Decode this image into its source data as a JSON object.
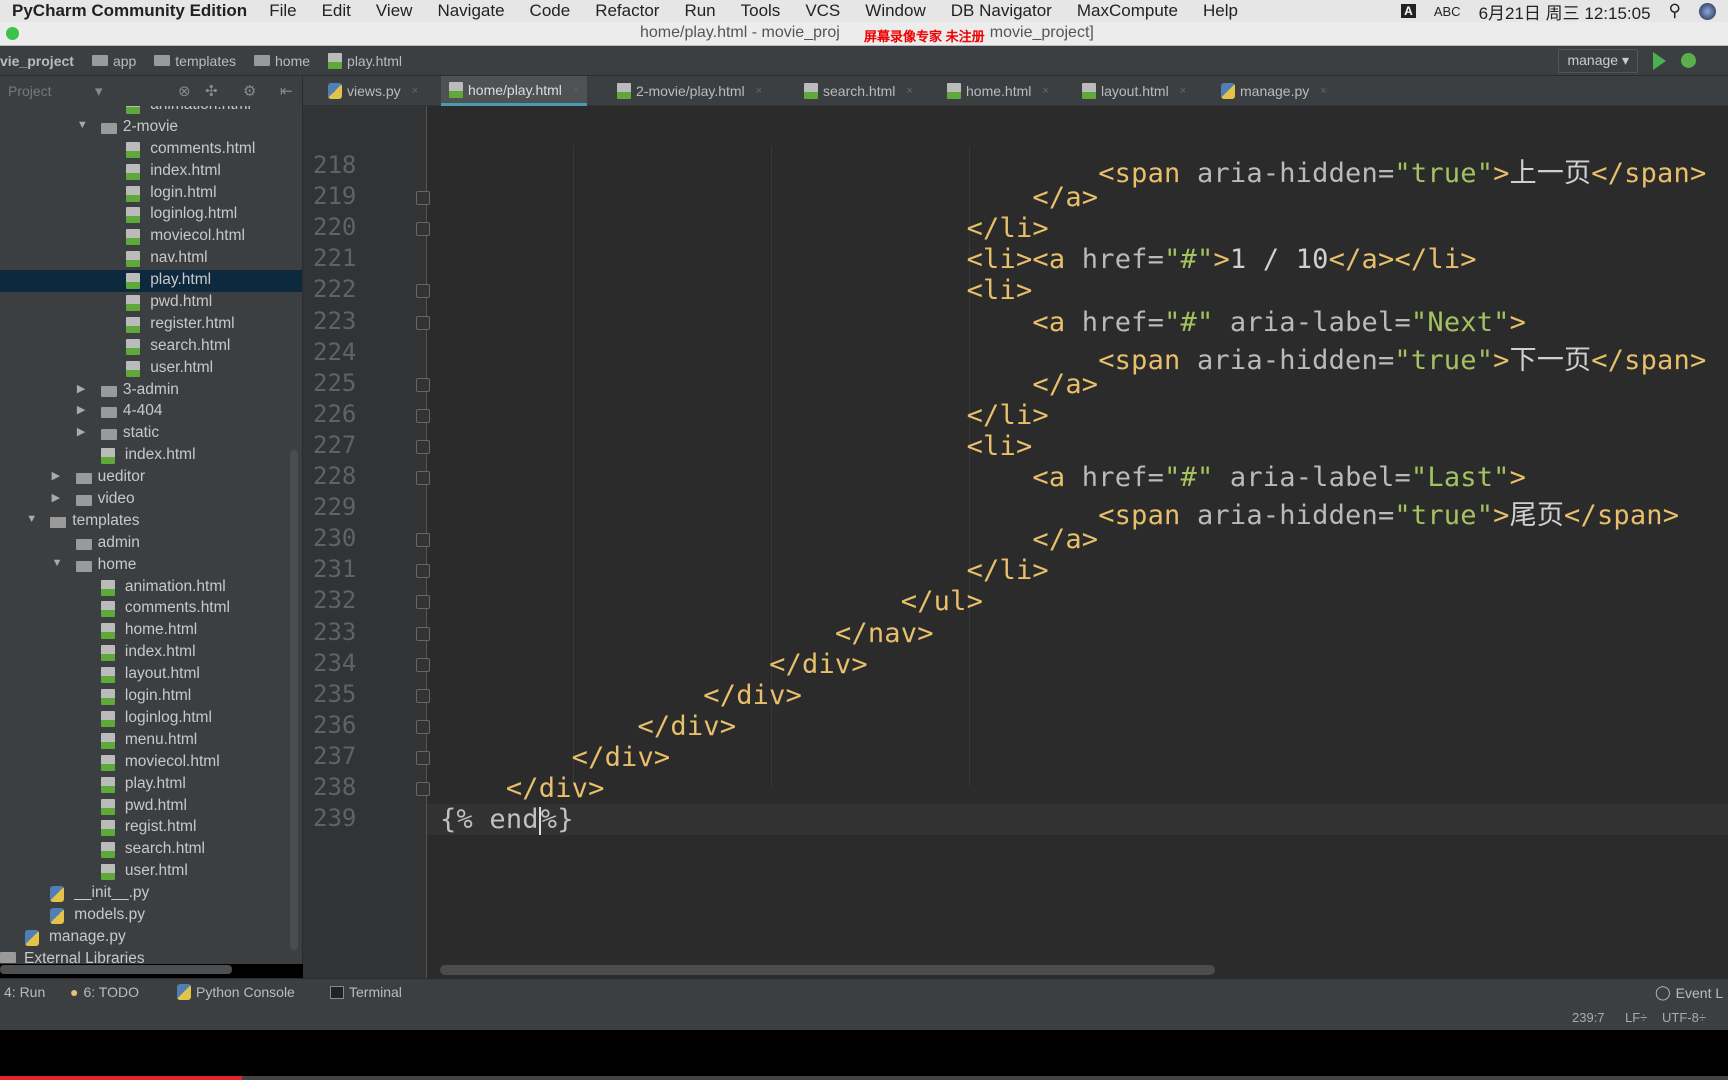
{
  "menubar": {
    "app": "PyCharm Community Edition",
    "items": [
      "File",
      "Edit",
      "View",
      "Navigate",
      "Code",
      "Refactor",
      "Run",
      "Tools",
      "VCS",
      "Window",
      "DB Navigator",
      "MaxCompute",
      "Help"
    ],
    "input_badge": "A",
    "input_source": "ABC",
    "datetime": "6月21日 周三 12:15:05"
  },
  "titlebar": {
    "title": "home/play.html - movie_proj",
    "title_suffix": "movie_project]",
    "watermark": "屏幕录像专家 未注册"
  },
  "breadcrumb": [
    "vie_project",
    "app",
    "templates",
    "home",
    "play.html"
  ],
  "run_config": "manage ▾",
  "project_panel": {
    "label": "Project"
  },
  "tabs": [
    {
      "label": "views.py",
      "icon": "python-file-icon"
    },
    {
      "label": "home/play.html",
      "icon": "html-file-icon",
      "active": true
    },
    {
      "label": "2-movie/play.html",
      "icon": "html-file-icon"
    },
    {
      "label": "search.html",
      "icon": "html-file-icon"
    },
    {
      "label": "home.html",
      "icon": "html-file-icon"
    },
    {
      "label": "layout.html",
      "icon": "html-file-icon"
    },
    {
      "label": "manage.py",
      "icon": "python-file-icon"
    }
  ],
  "tree": [
    {
      "name": "animation.html",
      "level": 4,
      "type": "html"
    },
    {
      "name": "2-movie",
      "level": 3,
      "type": "folder",
      "open": true
    },
    {
      "name": "comments.html",
      "level": 4,
      "type": "html"
    },
    {
      "name": "index.html",
      "level": 4,
      "type": "html"
    },
    {
      "name": "login.html",
      "level": 4,
      "type": "html"
    },
    {
      "name": "loginlog.html",
      "level": 4,
      "type": "html"
    },
    {
      "name": "moviecol.html",
      "level": 4,
      "type": "html"
    },
    {
      "name": "nav.html",
      "level": 4,
      "type": "html"
    },
    {
      "name": "play.html",
      "level": 4,
      "type": "html",
      "selected": true
    },
    {
      "name": "pwd.html",
      "level": 4,
      "type": "html"
    },
    {
      "name": "register.html",
      "level": 4,
      "type": "html"
    },
    {
      "name": "search.html",
      "level": 4,
      "type": "html"
    },
    {
      "name": "user.html",
      "level": 4,
      "type": "html"
    },
    {
      "name": "3-admin",
      "level": 3,
      "type": "folder",
      "open": false
    },
    {
      "name": "4-404",
      "level": 3,
      "type": "folder",
      "open": false
    },
    {
      "name": "static",
      "level": 3,
      "type": "folder",
      "open": false
    },
    {
      "name": "index.html",
      "level": 3,
      "type": "html"
    },
    {
      "name": "ueditor",
      "level": 2,
      "type": "folder",
      "open": false
    },
    {
      "name": "video",
      "level": 2,
      "type": "folder",
      "open": false
    },
    {
      "name": "templates",
      "level": 1,
      "type": "folder",
      "open": true
    },
    {
      "name": "admin",
      "level": 2,
      "type": "folder"
    },
    {
      "name": "home",
      "level": 2,
      "type": "folder",
      "open": true
    },
    {
      "name": "animation.html",
      "level": 3,
      "type": "html"
    },
    {
      "name": "comments.html",
      "level": 3,
      "type": "html"
    },
    {
      "name": "home.html",
      "level": 3,
      "type": "html"
    },
    {
      "name": "index.html",
      "level": 3,
      "type": "html"
    },
    {
      "name": "layout.html",
      "level": 3,
      "type": "html"
    },
    {
      "name": "login.html",
      "level": 3,
      "type": "html"
    },
    {
      "name": "loginlog.html",
      "level": 3,
      "type": "html"
    },
    {
      "name": "menu.html",
      "level": 3,
      "type": "html"
    },
    {
      "name": "moviecol.html",
      "level": 3,
      "type": "html"
    },
    {
      "name": "play.html",
      "level": 3,
      "type": "html"
    },
    {
      "name": "pwd.html",
      "level": 3,
      "type": "html"
    },
    {
      "name": "regist.html",
      "level": 3,
      "type": "html"
    },
    {
      "name": "search.html",
      "level": 3,
      "type": "html"
    },
    {
      "name": "user.html",
      "level": 3,
      "type": "html"
    },
    {
      "name": "__init__.py",
      "level": 1,
      "type": "py"
    },
    {
      "name": "models.py",
      "level": 1,
      "type": "py"
    },
    {
      "name": "manage.py",
      "level": 0,
      "type": "py"
    },
    {
      "name": "External Libraries",
      "level": -1,
      "type": "lib"
    }
  ],
  "code": [
    {
      "n": "218",
      "indent": 40,
      "tokens": [
        [
          "tag",
          "<span "
        ],
        [
          "attr",
          "aria-hidden="
        ],
        [
          "str",
          "\"true\""
        ],
        [
          "tag",
          ">"
        ],
        [
          "txt",
          "上一页"
        ],
        [
          "tag",
          "</span>"
        ]
      ]
    },
    {
      "n": "219",
      "indent": 36,
      "tokens": [
        [
          "tag",
          "</a>"
        ]
      ]
    },
    {
      "n": "220",
      "indent": 32,
      "tokens": [
        [
          "tag",
          "</li>"
        ]
      ]
    },
    {
      "n": "221",
      "indent": 32,
      "tokens": [
        [
          "tag",
          "<li><a "
        ],
        [
          "attr",
          "href="
        ],
        [
          "str",
          "\"#\""
        ],
        [
          "tag",
          ">"
        ],
        [
          "txt",
          "1 / 10"
        ],
        [
          "tag",
          "</a></li>"
        ]
      ]
    },
    {
      "n": "222",
      "indent": 32,
      "tokens": [
        [
          "tag",
          "<li>"
        ]
      ]
    },
    {
      "n": "223",
      "indent": 36,
      "tokens": [
        [
          "tag",
          "<a "
        ],
        [
          "attr",
          "href="
        ],
        [
          "str",
          "\"#\" "
        ],
        [
          "attr",
          "aria-label="
        ],
        [
          "str",
          "\"Next\""
        ],
        [
          "tag",
          ">"
        ]
      ]
    },
    {
      "n": "224",
      "indent": 40,
      "tokens": [
        [
          "tag",
          "<span "
        ],
        [
          "attr",
          "aria-hidden="
        ],
        [
          "str",
          "\"true\""
        ],
        [
          "tag",
          ">"
        ],
        [
          "txt",
          "下一页"
        ],
        [
          "tag",
          "</span>"
        ]
      ]
    },
    {
      "n": "225",
      "indent": 36,
      "tokens": [
        [
          "tag",
          "</a>"
        ]
      ]
    },
    {
      "n": "226",
      "indent": 32,
      "tokens": [
        [
          "tag",
          "</li>"
        ]
      ]
    },
    {
      "n": "227",
      "indent": 32,
      "tokens": [
        [
          "tag",
          "<li>"
        ]
      ]
    },
    {
      "n": "228",
      "indent": 36,
      "tokens": [
        [
          "tag",
          "<a "
        ],
        [
          "attr",
          "href="
        ],
        [
          "str",
          "\"#\" "
        ],
        [
          "attr",
          "aria-label="
        ],
        [
          "str",
          "\"Last\""
        ],
        [
          "tag",
          ">"
        ]
      ]
    },
    {
      "n": "229",
      "indent": 40,
      "tokens": [
        [
          "tag",
          "<span "
        ],
        [
          "attr",
          "aria-hidden="
        ],
        [
          "str",
          "\"true\""
        ],
        [
          "tag",
          ">"
        ],
        [
          "txt",
          "尾页"
        ],
        [
          "tag",
          "</span>"
        ]
      ]
    },
    {
      "n": "230",
      "indent": 36,
      "tokens": [
        [
          "tag",
          "</a>"
        ]
      ]
    },
    {
      "n": "231",
      "indent": 32,
      "tokens": [
        [
          "tag",
          "</li>"
        ]
      ]
    },
    {
      "n": "232",
      "indent": 28,
      "tokens": [
        [
          "tag",
          "</ul>"
        ]
      ]
    },
    {
      "n": "233",
      "indent": 24,
      "tokens": [
        [
          "tag",
          "</nav>"
        ]
      ]
    },
    {
      "n": "234",
      "indent": 20,
      "tokens": [
        [
          "tag",
          "</div>"
        ]
      ]
    },
    {
      "n": "235",
      "indent": 16,
      "tokens": [
        [
          "tag",
          "</div>"
        ]
      ]
    },
    {
      "n": "236",
      "indent": 12,
      "tokens": [
        [
          "tag",
          "</div>"
        ]
      ]
    },
    {
      "n": "237",
      "indent": 8,
      "tokens": [
        [
          "tag",
          "</div>"
        ]
      ]
    },
    {
      "n": "238",
      "indent": 4,
      "tokens": [
        [
          "tag",
          "</div>"
        ]
      ]
    },
    {
      "n": "239",
      "indent": 0,
      "current": true,
      "tokens": [
        [
          "tpl",
          "{% end"
        ],
        [
          "caret",
          ""
        ],
        [
          "tpl",
          "%}"
        ]
      ]
    }
  ],
  "toolwindows": {
    "run": "4: Run",
    "todo": "6: TODO",
    "python_console": "Python Console",
    "terminal": "Terminal",
    "event_log": "Event L"
  },
  "status": {
    "position": "239:7",
    "line_sep": "LF÷",
    "encoding": "UTF-8÷"
  },
  "video_progress": 0.14,
  "colors": {
    "accent": "#4a9bb0",
    "tag": "#e8bf6a",
    "string": "#a5c261",
    "selection": "#0d293e"
  }
}
